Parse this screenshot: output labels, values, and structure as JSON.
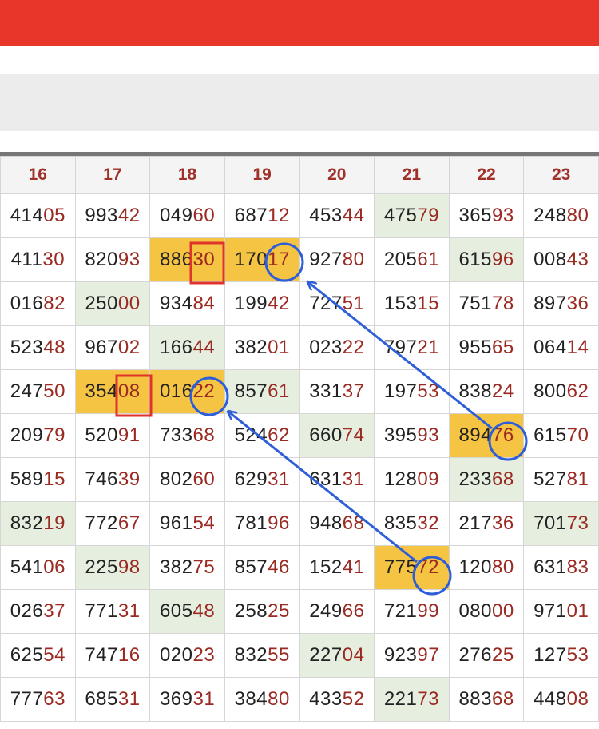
{
  "columns": [
    "16",
    "17",
    "18",
    "19",
    "20",
    "21",
    "22",
    "23"
  ],
  "rows": [
    [
      "41405",
      "99342",
      "04960",
      "68712",
      "45344",
      "47579",
      "36593",
      "24880"
    ],
    [
      "41130",
      "82093",
      "88630",
      "17017",
      "92780",
      "20561",
      "61596",
      "00843"
    ],
    [
      "01682",
      "25000",
      "93484",
      "19942",
      "72751",
      "15315",
      "75178",
      "89736"
    ],
    [
      "52348",
      "96702",
      "16644",
      "38201",
      "02322",
      "79721",
      "95565",
      "06414"
    ],
    [
      "24750",
      "35408",
      "01622",
      "85761",
      "33137",
      "19753",
      "83824",
      "80062"
    ],
    [
      "20979",
      "52091",
      "73368",
      "52462",
      "66074",
      "39593",
      "89476",
      "61570"
    ],
    [
      "58915",
      "74639",
      "80260",
      "62931",
      "63131",
      "12809",
      "23368",
      "52781"
    ],
    [
      "83219",
      "77267",
      "96154",
      "78196",
      "94868",
      "83532",
      "21736",
      "70173"
    ],
    [
      "54106",
      "22598",
      "38275",
      "85746",
      "15241",
      "77572",
      "12080",
      "63183"
    ],
    [
      "02637",
      "77131",
      "60548",
      "25825",
      "24966",
      "72199",
      "08000",
      "97101"
    ],
    [
      "62554",
      "74716",
      "02023",
      "83255",
      "22704",
      "92397",
      "27625",
      "12753"
    ],
    [
      "77763",
      "68531",
      "36931",
      "38480",
      "43352",
      "22173",
      "88368",
      "44808"
    ]
  ],
  "highlights": {
    "green": [
      [
        0,
        5
      ],
      [
        1,
        6
      ],
      [
        2,
        1
      ],
      [
        3,
        2
      ],
      [
        4,
        3
      ],
      [
        5,
        4
      ],
      [
        6,
        6
      ],
      [
        7,
        0
      ],
      [
        7,
        7
      ],
      [
        8,
        1
      ],
      [
        9,
        2
      ],
      [
        10,
        4
      ],
      [
        11,
        5
      ]
    ],
    "orange": [
      [
        1,
        2
      ],
      [
        1,
        3
      ],
      [
        4,
        1
      ],
      [
        4,
        2
      ],
      [
        5,
        6
      ],
      [
        8,
        5
      ]
    ]
  },
  "colors": {
    "header_bar": "#e8372a",
    "orange_highlight": "#f6c443",
    "green_highlight": "#e6efdf",
    "annotation_blue": "#2f5fd8",
    "annotation_red": "#e0332b",
    "tail_digits": "#9a2a22"
  }
}
